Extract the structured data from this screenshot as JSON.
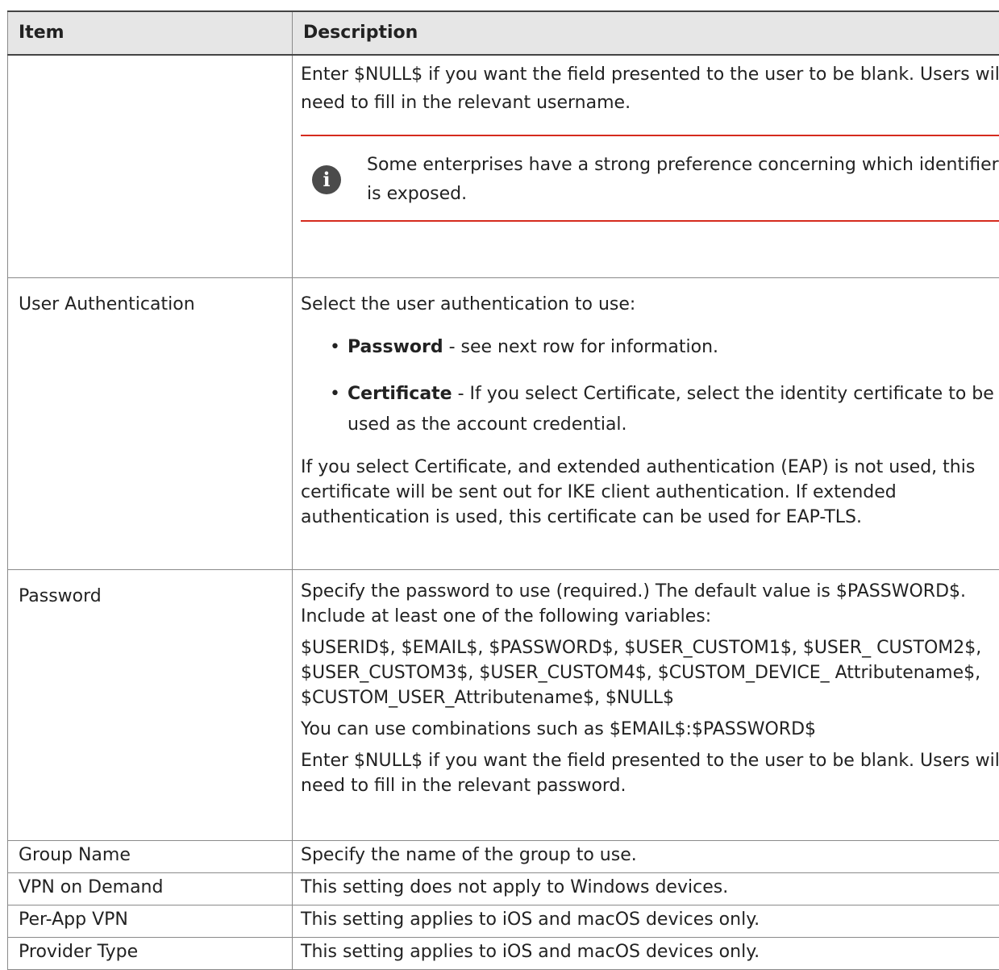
{
  "table": {
    "header": {
      "item": "Item",
      "description": "Description"
    },
    "row_username_cont": {
      "null_text": "Enter $NULL$ if you want the field presented to the user to be blank. Users will need to fill in the relevant username.",
      "note": "Some enterprises have a strong preference concerning which identifier is exposed.",
      "note_icon": "info-icon"
    },
    "row_user_auth": {
      "item": "User Authentication",
      "intro": "Select the user authentication to use:",
      "options": [
        {
          "term": "Password",
          "text": " - see next row for information."
        },
        {
          "term": "Certificate",
          "text": " - If you select Certificate, select the identity certificate to be used as the account credential."
        }
      ],
      "outro": "If you select Certificate, and extended authentication (EAP) is not used, this certificate will be sent out for IKE client authentication. If extended authentication is used, this certificate can be used for EAP-TLS."
    },
    "row_password": {
      "item": "Password",
      "p1": "Specify the password to use (required.) The default value is $PASSWORD$. Include at least one of the following variables:",
      "p2": "$USERID$, $EMAIL$, $PASSWORD$, $USER_CUSTOM1$, $USER_ CUSTOM2$, $USER_CUSTOM3$, $USER_CUSTOM4$, $CUSTOM_DEVICE_ Attributename$, $CUSTOM_USER_Attributename$, $NULL$",
      "p3": "You can use combinations such as $EMAIL$:$PASSWORD$",
      "p4": "Enter $NULL$ if you want the field presented to the user to be blank. Users will need to fill in the relevant password."
    },
    "rows_simple": [
      {
        "item": "Group Name",
        "description": "Specify the name of the group to use."
      },
      {
        "item": "VPN on Demand",
        "description": "This setting does not apply to Windows devices."
      },
      {
        "item": "Per-App VPN",
        "description": "This setting applies to iOS and macOS devices only."
      },
      {
        "item": "Provider Type",
        "description": "This setting applies to iOS and macOS devices only."
      }
    ],
    "bullet_char": "•"
  }
}
